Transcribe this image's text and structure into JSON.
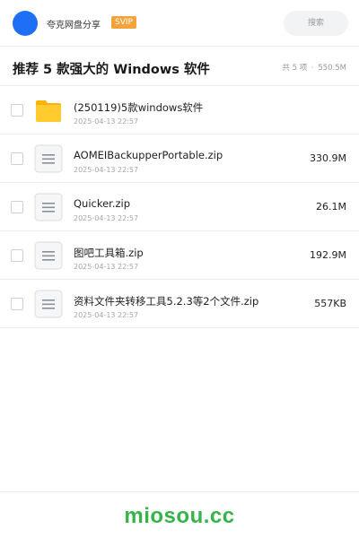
{
  "header": {
    "user_name": "夸克网盘分享",
    "badge": "SVIP",
    "search_placeholder": "搜索",
    "avatar_color": "#1e6ff5",
    "badge_color": "#f3a33a"
  },
  "share": {
    "title": "推荐 5 款强大的 Windows 软件",
    "count": "共 5 项",
    "separator": "·",
    "total_size": "550.5M"
  },
  "files": [
    {
      "name": "(250119)5款windows软件",
      "date": "2025-04-13 22:57",
      "size": "",
      "icon": "folder-icon"
    },
    {
      "name": "AOMEIBackupperPortable.zip",
      "date": "2025-04-13 22:57",
      "size": "330.9M",
      "icon": "file-icon"
    },
    {
      "name": "Quicker.zip",
      "date": "2025-04-13 22:57",
      "size": "26.1M",
      "icon": "file-icon"
    },
    {
      "name": "图吧工具箱.zip",
      "date": "2025-04-13 22:57",
      "size": "192.9M",
      "icon": "file-icon"
    },
    {
      "name": "资料文件夹转移工具5.2.3等2个文件.zip",
      "date": "2025-04-13 22:57",
      "size": "557KB",
      "icon": "file-icon"
    }
  ],
  "footer": {
    "watermark": "miosou.cc",
    "watermark_color": "#36b34a"
  }
}
